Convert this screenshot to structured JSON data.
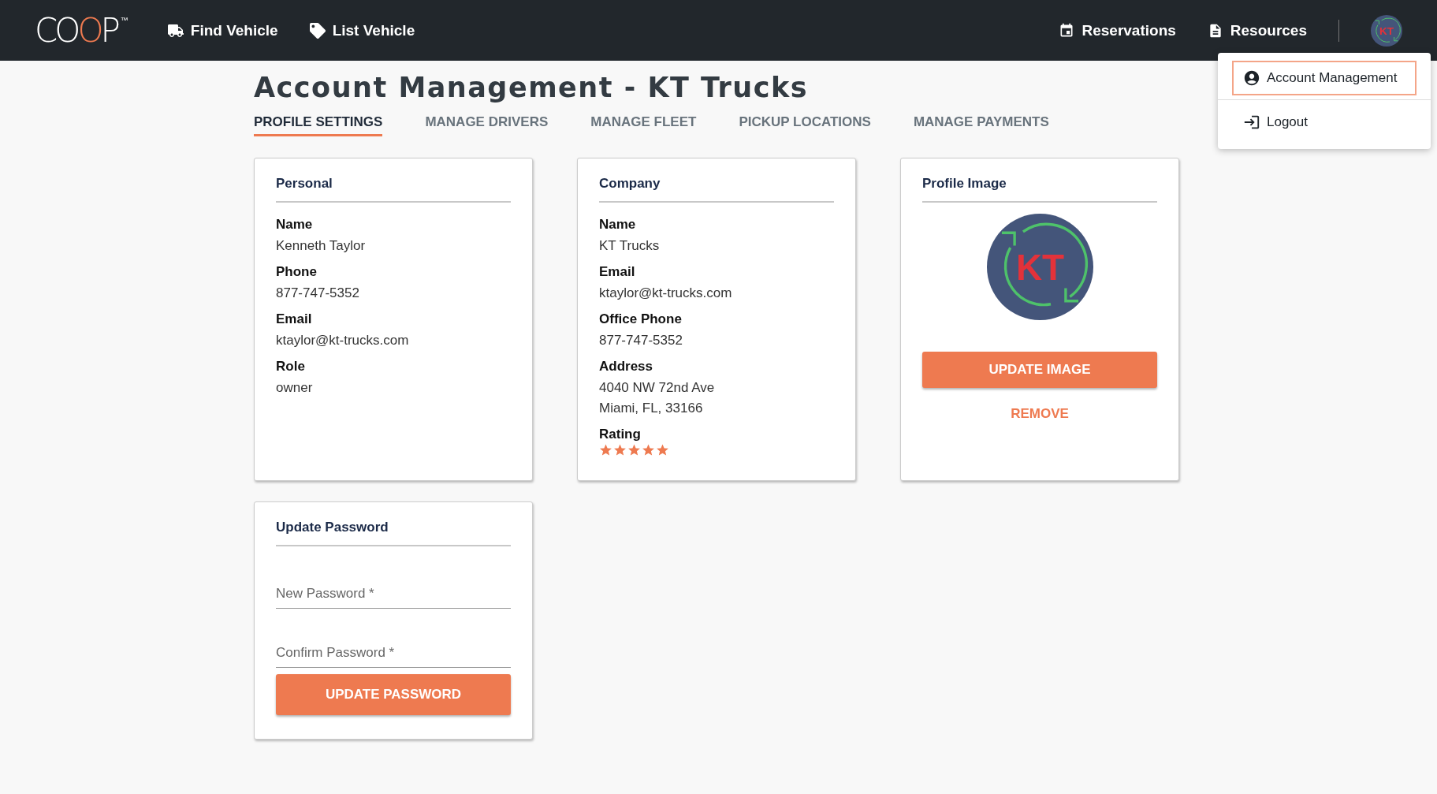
{
  "header": {
    "logo": {
      "text": "COOP",
      "mark": "™"
    },
    "nav_left": [
      {
        "label": "Find Vehicle",
        "kind": "truck"
      },
      {
        "label": "List Vehicle",
        "kind": "tag"
      }
    ],
    "nav_right": [
      {
        "label": "Reservations",
        "kind": "calendar"
      },
      {
        "label": "Resources",
        "kind": "document"
      }
    ],
    "avatar": {
      "initials": "KT"
    }
  },
  "user_menu": {
    "items": [
      {
        "label": "Account Management",
        "kind": "account",
        "selected": true
      },
      {
        "label": "Logout",
        "kind": "logout",
        "selected": false
      }
    ]
  },
  "page": {
    "title": "Account Management - KT Trucks",
    "tabs": [
      {
        "label": "PROFILE SETTINGS",
        "selected": true
      },
      {
        "label": "MANAGE DRIVERS",
        "selected": false
      },
      {
        "label": "MANAGE FLEET",
        "selected": false
      },
      {
        "label": "PICKUP LOCATIONS",
        "selected": false
      },
      {
        "label": "MANAGE PAYMENTS",
        "selected": false
      }
    ]
  },
  "personal": {
    "title": "Personal",
    "fields": [
      {
        "label": "Name",
        "value": [
          "Kenneth Taylor"
        ]
      },
      {
        "label": "Phone",
        "value": [
          "877-747-5352"
        ]
      },
      {
        "label": "Email",
        "value": [
          "ktaylor@kt-trucks.com"
        ]
      },
      {
        "label": "Role",
        "value": [
          "owner"
        ]
      }
    ]
  },
  "company": {
    "title": "Company",
    "fields": [
      {
        "label": "Name",
        "value": [
          "KT Trucks"
        ]
      },
      {
        "label": "Email",
        "value": [
          "ktaylor@kt-trucks.com"
        ]
      },
      {
        "label": "Office Phone",
        "value": [
          "877-747-5352"
        ]
      },
      {
        "label": "Address",
        "value": [
          "4040 NW 72nd Ave",
          "Miami, FL, 33166"
        ]
      }
    ],
    "rating": {
      "label": "Rating",
      "stars": 5
    }
  },
  "profile_image": {
    "title": "Profile Image",
    "initials": "KT",
    "update_button": "UPDATE IMAGE",
    "remove_button": "REMOVE"
  },
  "update_password": {
    "title": "Update Password",
    "fields": [
      {
        "placeholder": "New Password *"
      },
      {
        "placeholder": "Confirm Password *"
      }
    ],
    "button": "UPDATE PASSWORD"
  }
}
